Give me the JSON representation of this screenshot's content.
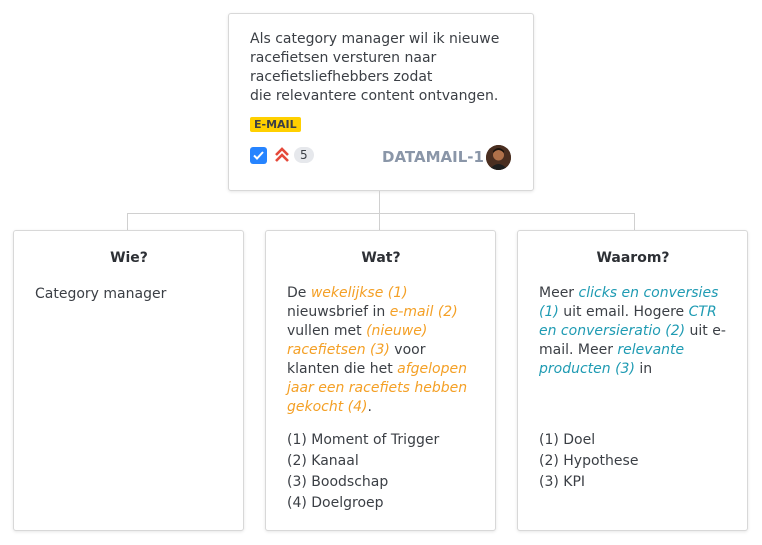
{
  "story": {
    "description": "Als category manager wil ik nieuwe\nracefietsen versturen naar\nracefietsliefhebbers zodat\ndie relevantere content ontvangen.",
    "label": "E-MAIL",
    "story_points": "5",
    "issue_key": "DATAMAIL-1",
    "colors": {
      "label_bg": "#ffd000",
      "checkbox": "#2684ff",
      "priority": "#e5493a",
      "key": "#8a96a8"
    }
  },
  "columns": {
    "wie": {
      "title": "Wie?",
      "body": "Category manager"
    },
    "wat": {
      "title": "Wat?",
      "body": {
        "t1": "De ",
        "h1": "wekelijkse (1)",
        "t2": " nieuwsbrief in ",
        "h2": "e-mail (2)",
        "t3": " vullen met ",
        "h3": "(nieuwe) racefietsen (3)",
        "t4": " voor klanten die het ",
        "h4": "afgelopen jaar een racefiets hebben gekocht (4)",
        "t5": "."
      },
      "legend": [
        "(1) Moment of Trigger",
        "(2) Kanaal",
        "(3) Boodschap",
        "(4) Doelgroep"
      ]
    },
    "waarom": {
      "title": "Waarom?",
      "body": {
        "t1": "Meer ",
        "h1": "clicks en conversies (1)",
        "t2": " uit email. Hogere ",
        "h2": "CTR en conversieratio (2)",
        "t3": " uit e-mail. Meer ",
        "h3": "relevante producten (3)",
        "t4": " in"
      },
      "legend": [
        "(1) Doel",
        "(2) Hypothese",
        "(3) KPI"
      ]
    }
  },
  "highlight_colors": {
    "wat": "#f4a026",
    "waarom": "#1f9bb3"
  }
}
